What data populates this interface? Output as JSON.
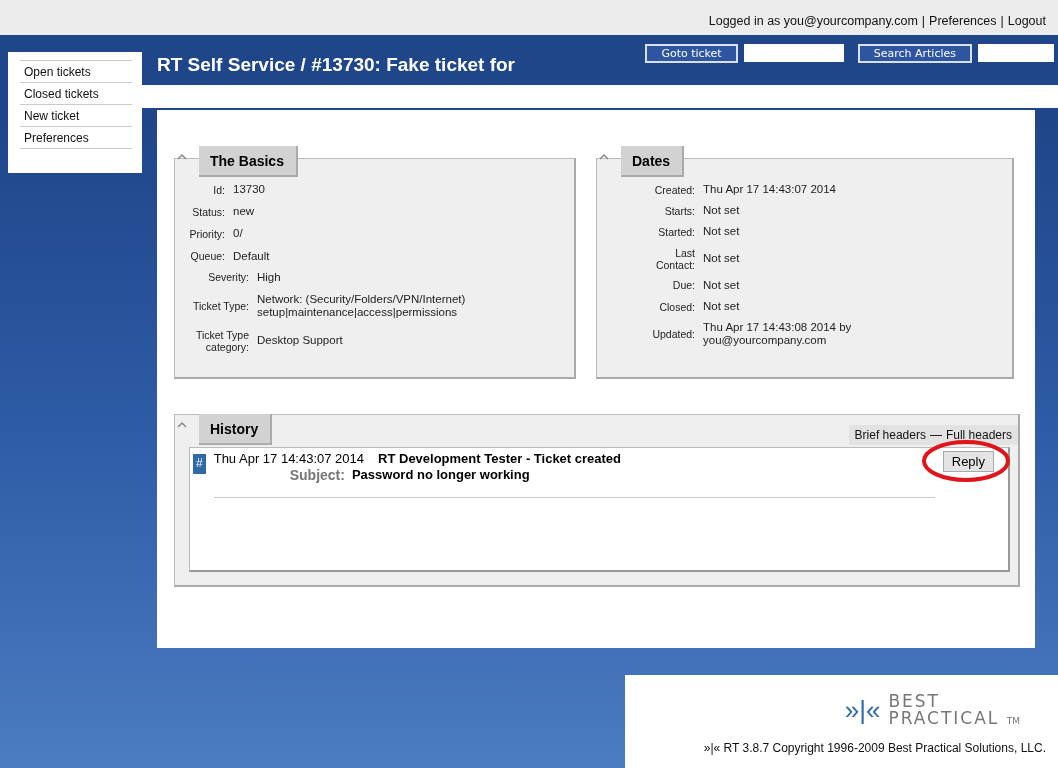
{
  "top_bar": {
    "logged_in": "Logged in as you@yourcompany.com",
    "links": [
      "Preferences",
      "Logout"
    ],
    "separator": "|"
  },
  "sidebar": {
    "items": [
      {
        "label": "Open tickets",
        "selected": false
      },
      {
        "label": "Closed tickets",
        "selected": false
      },
      {
        "label": "New ticket",
        "selected": false
      },
      {
        "label": "Preferences",
        "selected": false
      }
    ]
  },
  "header": {
    "title": "RT Self Service / #13730: Fake ticket for",
    "goto_button": "Goto ticket",
    "search_button": "Search Articles"
  },
  "basics": {
    "title": "The Basics",
    "expanded": true,
    "groups": [
      [
        {
          "label": "Id:",
          "value": "13730"
        },
        {
          "label": "Status:",
          "value": "new"
        },
        {
          "label": "Priority:",
          "value": "0/"
        },
        {
          "label": "Queue:",
          "value": "Default"
        }
      ],
      [
        {
          "label": "Severity:",
          "value": "High"
        },
        {
          "label": "Ticket Type:",
          "value": "Network: (Security/Folders/VPN/Internet) setup|maintenance|access|permissions"
        },
        {
          "label": "Ticket Type category:",
          "value": "Desktop Support"
        }
      ]
    ]
  },
  "dates": {
    "title": "Dates",
    "expanded": true,
    "fields": [
      {
        "label": "Created:",
        "value": "Thu Apr 17 14:43:07 2014"
      },
      {
        "label": "Starts:",
        "value": "Not set"
      },
      {
        "label": "Started:",
        "value": "Not set"
      },
      {
        "label": "Last Contact:",
        "value": "Not set"
      },
      {
        "label": "Due:",
        "value": "Not set"
      },
      {
        "label": "Closed:",
        "value": "Not set"
      },
      {
        "label": "Updated:",
        "value": "Thu Apr 17 14:43:08 2014 by you@yourcompany.com"
      }
    ]
  },
  "history": {
    "title": "History",
    "expanded": true,
    "header_options": [
      "Brief headers",
      "Full headers"
    ],
    "header_separator": "—",
    "entries": [
      {
        "marker": "#",
        "date": "Thu Apr 17 14:43:07 2014",
        "description": "RT Development Tester - Ticket created",
        "subject_label": "Subject:",
        "subject": "Password no longer working",
        "reply_button": "Reply",
        "highlighted": true
      }
    ]
  },
  "footer": {
    "logo_mark": "»|«",
    "logo_line1": "BEST",
    "logo_line2": "PRACTICAL",
    "logo_tm": "TM",
    "copyright": "»|« RT 3.8.7 Copyright 1996-2009 Best Practical Solutions, LLC."
  }
}
